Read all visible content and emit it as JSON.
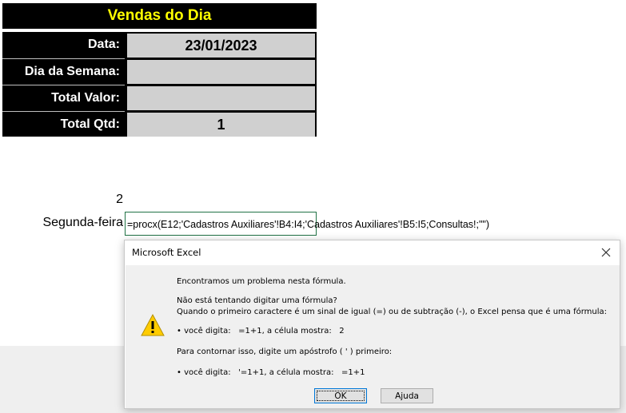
{
  "sheet": {
    "title": "Vendas do Dia",
    "rows": [
      {
        "label": "Data:",
        "value": "23/01/2023"
      },
      {
        "label": "Dia da Semana:",
        "value": ""
      },
      {
        "label": "Total Valor:",
        "value": ""
      },
      {
        "label": "Total Qtd:",
        "value": "1"
      }
    ],
    "cell_number": "2",
    "cell_weekday": "Segunda-feira",
    "formula": "=procx(E12;'Cadastros Auxiliares'!B4:I4;'Cadastros Auxiliares'!B5:I5;Consultas!;\"\")"
  },
  "colors": {
    "title_text": "#ffff00",
    "header_bg": "#000000",
    "value_bg": "#d0d0d0",
    "active_cell_border": "#217346"
  },
  "dialog": {
    "title": "Microsoft Excel",
    "close_icon": "close-icon",
    "warning_icon": "warning-icon",
    "line1": "Encontramos um problema nesta fórmula.",
    "line2": "Não está tentando digitar uma fórmula?",
    "line3": "Quando o primeiro caractere é um sinal de igual (=) ou de subtração (-), o Excel pensa que é uma fórmula:",
    "line4": "• você digita:   =1+1, a célula mostra:   2",
    "line5": "Para contornar isso, digite um apóstrofo ( ' ) primeiro:",
    "line6": "• você digita:   '=1+1, a célula mostra:   =1+1",
    "ok_label": "OK",
    "help_label": "Ajuda"
  }
}
